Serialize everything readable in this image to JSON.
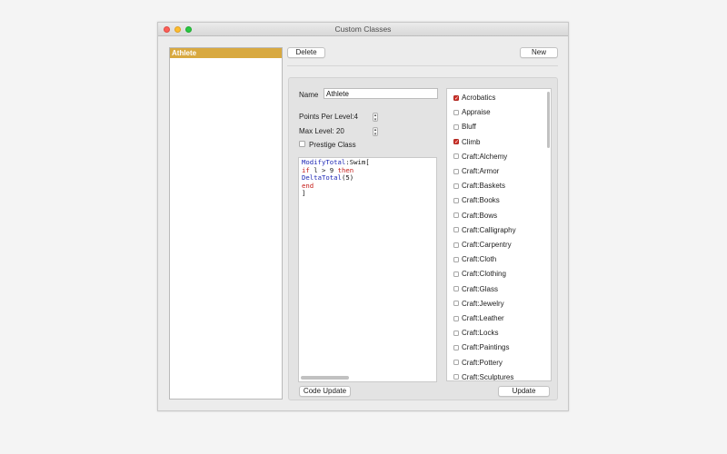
{
  "window": {
    "title": "Custom Classes"
  },
  "classes": [
    "Athlete"
  ],
  "toolbar": {
    "delete_label": "Delete",
    "new_label": "New"
  },
  "form": {
    "name_label": "Name",
    "name_value": "Athlete",
    "points_label": "Points Per Level:4",
    "max_level_label": "Max Level: 20",
    "prestige_label": "Prestige Class",
    "prestige_checked": false
  },
  "code": {
    "lines": [
      [
        {
          "t": "ModifyTotal",
          "c": "blue"
        },
        {
          "t": ":Swim["
        }
      ],
      [
        {
          "t": "if",
          "c": "red"
        },
        {
          "t": " l > 9 "
        },
        {
          "t": "then",
          "c": "red"
        }
      ],
      [
        {
          "t": "DeltaTotal",
          "c": "blue"
        },
        {
          "t": "(5)"
        }
      ],
      [
        {
          "t": "end",
          "c": "red"
        }
      ],
      [
        {
          "t": "]"
        }
      ]
    ]
  },
  "skills": [
    {
      "label": "Acrobatics",
      "checked": true
    },
    {
      "label": "Appraise",
      "checked": false
    },
    {
      "label": "Bluff",
      "checked": false
    },
    {
      "label": "Climb",
      "checked": true
    },
    {
      "label": "Craft:Alchemy",
      "checked": false
    },
    {
      "label": "Craft:Armor",
      "checked": false
    },
    {
      "label": "Craft:Baskets",
      "checked": false
    },
    {
      "label": "Craft:Books",
      "checked": false
    },
    {
      "label": "Craft:Bows",
      "checked": false
    },
    {
      "label": "Craft:Calligraphy",
      "checked": false
    },
    {
      "label": "Craft:Carpentry",
      "checked": false
    },
    {
      "label": "Craft:Cloth",
      "checked": false
    },
    {
      "label": "Craft:Clothing",
      "checked": false
    },
    {
      "label": "Craft:Glass",
      "checked": false
    },
    {
      "label": "Craft:Jewelry",
      "checked": false
    },
    {
      "label": "Craft:Leather",
      "checked": false
    },
    {
      "label": "Craft:Locks",
      "checked": false
    },
    {
      "label": "Craft:Paintings",
      "checked": false
    },
    {
      "label": "Craft:Pottery",
      "checked": false
    },
    {
      "label": "Craft:Sculptures",
      "checked": false
    }
  ],
  "buttons": {
    "code_update_label": "Code Update",
    "update_label": "Update"
  },
  "colors": {
    "selection": "#d8a940",
    "checkbox_checked": "#d0332b",
    "keyword_blue": "#1e28b5",
    "keyword_red": "#c41a16"
  }
}
